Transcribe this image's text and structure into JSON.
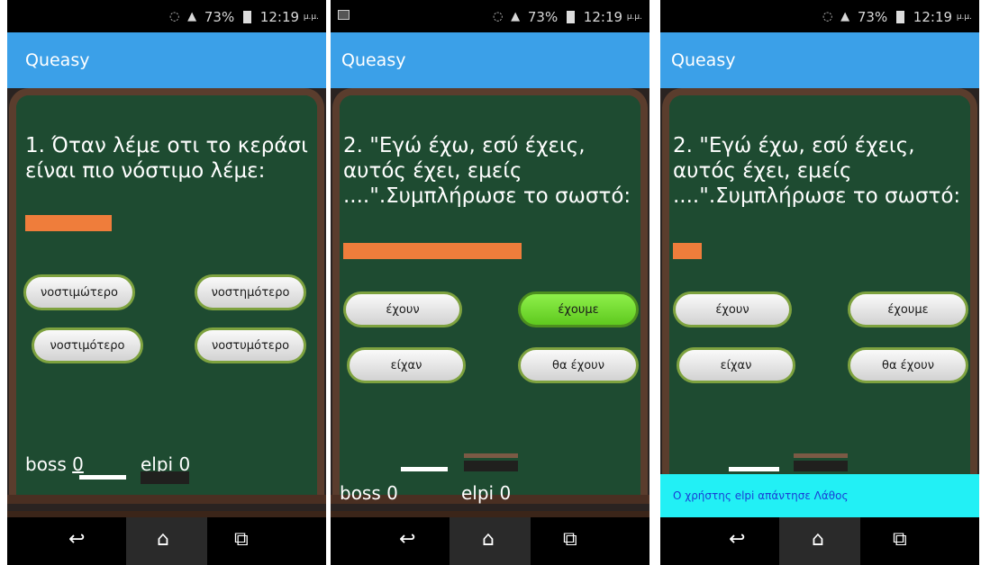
{
  "app_title": "Queasy",
  "status": {
    "battery": "73%",
    "time": "12:19",
    "ampm": "μ.μ."
  },
  "nav": {
    "back": "↩",
    "home": "⌂",
    "recents": "⧉"
  },
  "screens": [
    {
      "question": "1. Όταν λέμε οτι το κεράσι είναι πιο νόστιμο λέμε:",
      "answers": [
        "νοστιμώτερο",
        "νοστημότερο",
        "νοστιμότερο",
        "νοστυμότερο"
      ],
      "selected": null,
      "score": {
        "boss_label": "boss",
        "boss": "0",
        "elpi_label": "elpi",
        "elpi": "0"
      }
    },
    {
      "question": "2. \"Εγώ έχω, εσύ έχεις, αυτός έχει, εμείς ....\".Συμπλήρωσε το σωστό:",
      "answers": [
        "έχουν",
        "έχουμε",
        "είχαν",
        "θα έχουν"
      ],
      "selected": "έχουμε",
      "score": {
        "boss_label": "boss",
        "boss": "0",
        "elpi_label": "elpi",
        "elpi": "0"
      }
    },
    {
      "question": "2. \"Εγώ έχω, εσύ έχεις, αυτός έχει, εμείς ....\".Συμπλήρωσε το σωστό:",
      "answers": [
        "έχουν",
        "έχουμε",
        "είχαν",
        "θα έχουν"
      ],
      "selected": null,
      "toast": "Ο χρήστης elpi απάντησε  Λάθος"
    }
  ],
  "colors": {
    "actionbar": "#3ba0e8",
    "board": "#1e4b31",
    "blank": "#ef7d3b",
    "selected": "#6fd62a",
    "toast": "#22f0f5"
  },
  "icons": [
    "wifi-signal-icon",
    "battery-icon",
    "alarm-icon",
    "back-icon",
    "home-icon",
    "recents-icon",
    "image-notification-icon"
  ]
}
